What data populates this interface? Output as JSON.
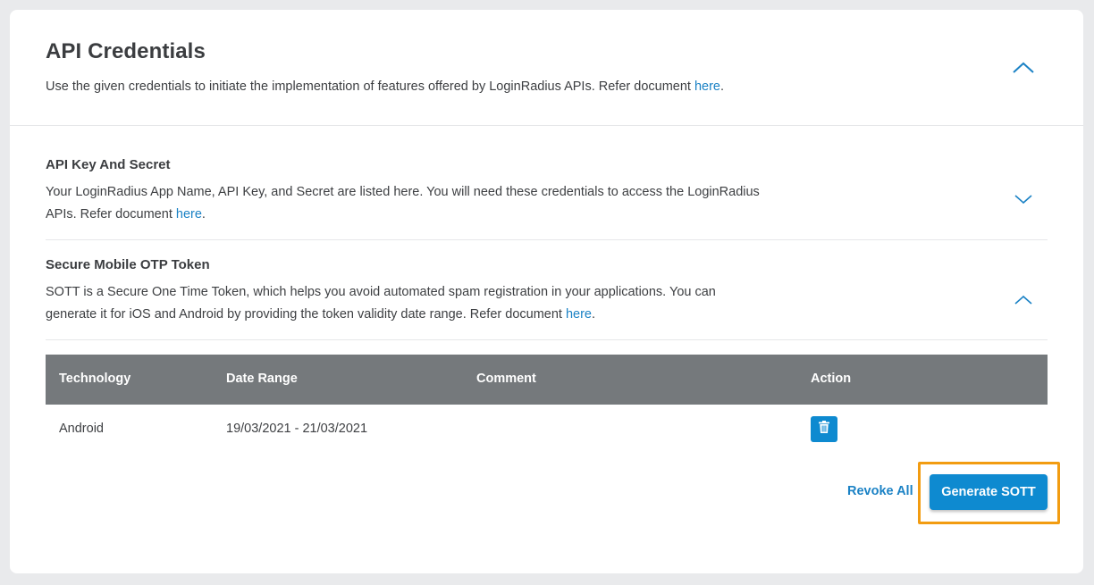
{
  "header": {
    "title": "API Credentials",
    "description": "Use the given credentials to initiate the implementation of features offered by LoginRadius APIs. Refer document ",
    "link_text": "here",
    "trailing": "."
  },
  "sections": [
    {
      "title": "API Key And Secret",
      "description": "Your LoginRadius App Name, API Key, and Secret are listed here. You will need these credentials to access the LoginRadius APIs. Refer document ",
      "link_text": "here",
      "trailing": ".",
      "chevron": "chevron-down-icon"
    },
    {
      "title": "Secure Mobile OTP Token",
      "description": "SOTT is a Secure One Time Token, which helps you avoid automated spam registration in your applications. You can generate it for iOS and Android by providing the token validity date range. Refer document ",
      "link_text": "here",
      "trailing": ".",
      "chevron": "chevron-up-icon"
    }
  ],
  "table": {
    "headers": [
      "Technology",
      "Date Range",
      "Comment",
      "Action"
    ],
    "rows": [
      {
        "technology": "Android",
        "date_range": "19/03/2021 - 21/03/2021",
        "comment": "",
        "action_icon": "trash-icon"
      }
    ]
  },
  "actions": {
    "revoke_label": "Revoke All",
    "generate_label": "Generate SOTT"
  },
  "colors": {
    "accent": "#0e8ad0",
    "link": "#1b82c5",
    "table_header": "#75797c",
    "highlight": "#f29c11"
  }
}
